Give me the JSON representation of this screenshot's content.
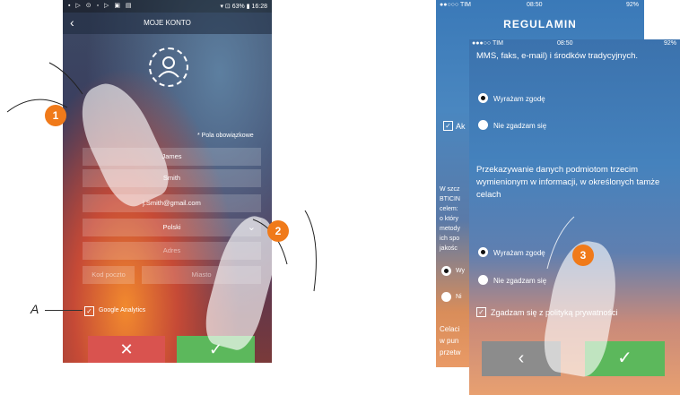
{
  "left_phone": {
    "status_left": "▪ ▷ ⊙ ▫ ▷ ▣ ▤",
    "status_right": "▾ ⊡ 63% ▮ 16:28",
    "title": "MOJE KONTO",
    "back_icon": "chevron-left-icon",
    "required_note": "* Pola obowiązkowe",
    "fields": {
      "first_name": "James",
      "last_name": "Smith",
      "email": "j.Smith@gmail.com",
      "language": "Polski",
      "address": "Adres",
      "postcode": "Kod poczto",
      "city": "Miasto"
    },
    "analytics_label": "Google Analytics",
    "analytics_checked": true,
    "cancel_glyph": "✕",
    "confirm_glyph": "✓"
  },
  "badges": {
    "one": "1",
    "two": "2",
    "three": "3"
  },
  "annotation": {
    "a_label": "A"
  },
  "right_back_phone": {
    "status_left": "●●○○○ TIM",
    "status_time": "08:50",
    "status_right": "92%",
    "title": "REGULAMIN",
    "partial_accept": "Ak",
    "partial_lines": [
      "W szcz",
      "BTICIN",
      "celem:",
      "o który",
      "metody",
      "ich spo",
      "jakośc"
    ],
    "partial_radio1": "Wy",
    "partial_radio2": "Ni",
    "partial_bottom": [
      "Celaci",
      "w pun",
      "przetw"
    ]
  },
  "right_front_phone": {
    "status_left": "●●●○○ TIM",
    "status_time": "08:50",
    "status_right": "92%",
    "intro_text": "MMS, faks, e-mail) i środków tradycyjnych.",
    "radio_agree_1": "Wyrażam zgodę",
    "radio_disagree_1": "Nie zgadzam się",
    "section_text": "Przekazywanie danych podmiotom trzecim wymienionym w informacji, w określonych tamże celach",
    "radio_agree_2": "Wyrażam zgodę",
    "radio_disagree_2": "Nie zgadzam się",
    "privacy_label": "Zgadzam się z polityką prywatności",
    "privacy_checked": true,
    "back_glyph": "‹",
    "confirm_glyph": "✓"
  }
}
